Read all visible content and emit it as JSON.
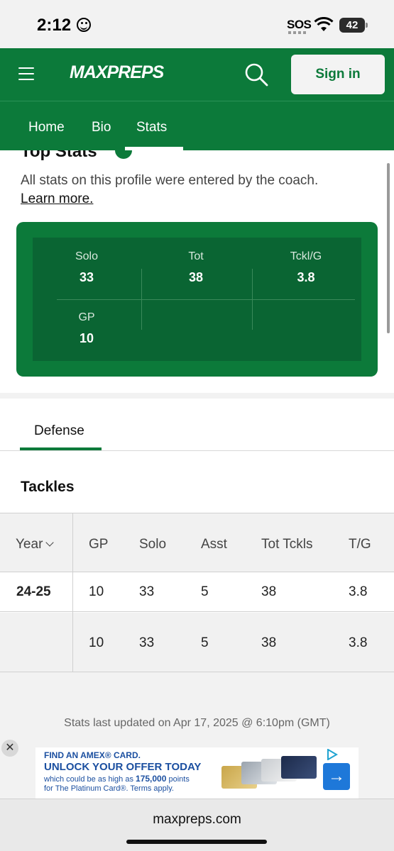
{
  "status_bar": {
    "time": "2:12",
    "sos": "SOS",
    "battery": "42"
  },
  "header": {
    "logo": "MAXPREPS",
    "signin_label": "Sign in"
  },
  "nav": {
    "tabs": [
      {
        "label": "Home"
      },
      {
        "label": "Bio"
      },
      {
        "label": "Stats"
      }
    ],
    "active": "Stats"
  },
  "top_stats": {
    "title": "Top Stats",
    "info": "All stats on this profile were entered by the coach.",
    "learn_more": "Learn more.",
    "items": [
      {
        "label": "Solo",
        "value": "33"
      },
      {
        "label": "Tot",
        "value": "38"
      },
      {
        "label": "Tckl/G",
        "value": "3.8"
      },
      {
        "label": "GP",
        "value": "10"
      }
    ]
  },
  "defense": {
    "tab_label": "Defense",
    "section_title": "Tackles",
    "columns": [
      "Year",
      "GP",
      "Solo",
      "Asst",
      "Tot Tckls",
      "T/G"
    ],
    "rows": [
      {
        "year": "24-25",
        "gp": "10",
        "solo": "33",
        "asst": "5",
        "tot": "38",
        "tg": "3.8"
      },
      {
        "year": "",
        "gp": "10",
        "solo": "33",
        "asst": "5",
        "tot": "38",
        "tg": "3.8"
      }
    ]
  },
  "updated_text": "Stats last updated on Apr 17, 2025 @ 6:10pm (GMT)",
  "ad": {
    "line1": "FIND AN AMEX® CARD.",
    "line2": "UNLOCK YOUR OFFER TODAY",
    "line3a": "which could be as high as",
    "line3b": "175,000",
    "line3c": "points",
    "line4": "for The Platinum Card®. Terms apply."
  },
  "url": "maxpreps.com"
}
